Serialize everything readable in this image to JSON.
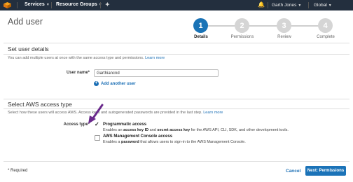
{
  "nav": {
    "services": "Services",
    "resource_groups": "Resource Groups",
    "user": "Garth Jones",
    "region": "Global"
  },
  "page": {
    "title": "Add user"
  },
  "wizard": {
    "steps": [
      {
        "number": "1",
        "label": "Details"
      },
      {
        "number": "2",
        "label": "Permissions"
      },
      {
        "number": "3",
        "label": "Review"
      },
      {
        "number": "4",
        "label": "Complete"
      }
    ]
  },
  "user_details": {
    "title": "Set user details",
    "description": "You can add multiple users at once with the same access type and permissions.",
    "learn_more": "Learn more",
    "user_name_label": "User name*",
    "user_name_value": "Garthiancnd",
    "add_another": "Add another user"
  },
  "access": {
    "title": "Select AWS access type",
    "description_1": "Select how these users will access AWS. Access keys and autogenerated passwords are provided in the last step.",
    "learn_more": "Learn more",
    "access_type_label": "Access type*",
    "programmatic": {
      "title": "Programmatic access",
      "desc_pre": "Enables an ",
      "desc_b1": "access key ID",
      "desc_mid": " and ",
      "desc_b2": "secret access key",
      "desc_post": " for the AWS API, CLI, SDK, and other development tools."
    },
    "console": {
      "title": "AWS Management Console access",
      "desc_pre": "Enables a ",
      "desc_b": "password",
      "desc_post": " that allows users to sign-in to the AWS Management Console."
    }
  },
  "footer": {
    "required": "* Required",
    "cancel": "Cancel",
    "next": "Next: Permissions"
  }
}
